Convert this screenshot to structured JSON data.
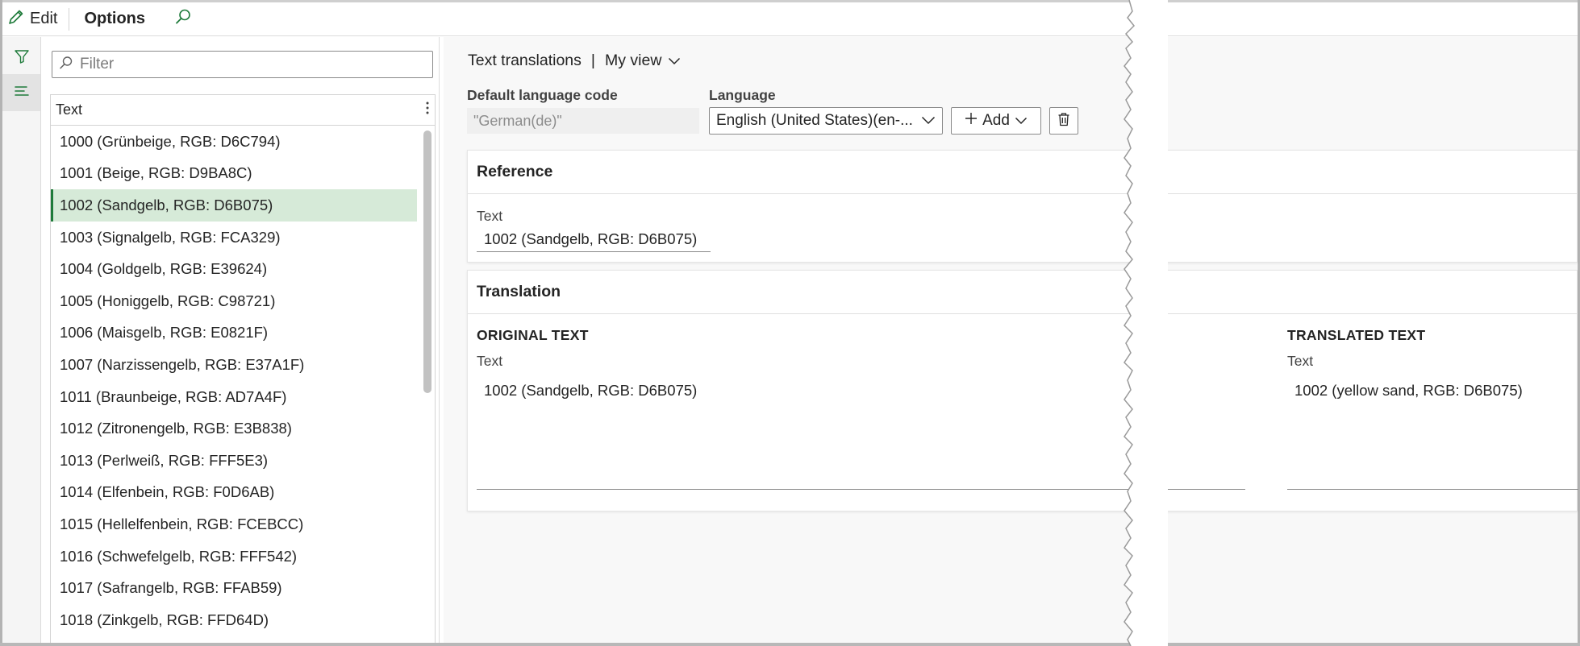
{
  "toolbar": {
    "edit_label": "Edit",
    "options_label": "Options"
  },
  "filter": {
    "placeholder": "Filter"
  },
  "grid": {
    "column_header": "Text",
    "rows": [
      "1000 (Grünbeige, RGB: D6C794)",
      "1001 (Beige, RGB: D9BA8C)",
      "1002 (Sandgelb, RGB: D6B075)",
      "1003 (Signalgelb, RGB: FCA329)",
      "1004 (Goldgelb, RGB: E39624)",
      "1005 (Honiggelb, RGB: C98721)",
      "1006 (Maisgelb, RGB: E0821F)",
      "1007 (Narzissengelb, RGB: E37A1F)",
      "1011 (Braunbeige, RGB: AD7A4F)",
      "1012 (Zitronengelb, RGB: E3B838)",
      "1013 (Perlweiß, RGB: FFF5E3)",
      "1014 (Elfenbein, RGB: F0D6AB)",
      "1015 (Hellelfenbein, RGB: FCEBCC)",
      "1016 (Schwefelgelb, RGB: FFF542)",
      "1017 (Safrangelb, RGB: FFAB59)",
      "1018 (Zinkgelb, RGB: FFD64D)"
    ],
    "selected_index": 2
  },
  "detail": {
    "title": "Text translations",
    "separator": "|",
    "view_name": "My view",
    "default_language_label": "Default language code",
    "default_language_value": "\"German(de)\"",
    "language_label": "Language",
    "language_value": "English (United States)(en-...",
    "add_label": "Add",
    "reference": {
      "title": "Reference",
      "text_label": "Text",
      "text_value": "1002 (Sandgelb, RGB: D6B075)"
    },
    "translation": {
      "title": "Translation",
      "original_header": "ORIGINAL TEXT",
      "original_label": "Text",
      "original_value": "1002 (Sandgelb, RGB: D6B075)",
      "translated_header": "TRANSLATED TEXT",
      "translated_label": "Text",
      "translated_value": "1002 (yellow sand, RGB: D6B075)"
    }
  },
  "colors": {
    "selected_row_bg": "#d6ead8",
    "selected_row_accent": "#1e7a3a",
    "icon_green": "#1e7a3a"
  }
}
